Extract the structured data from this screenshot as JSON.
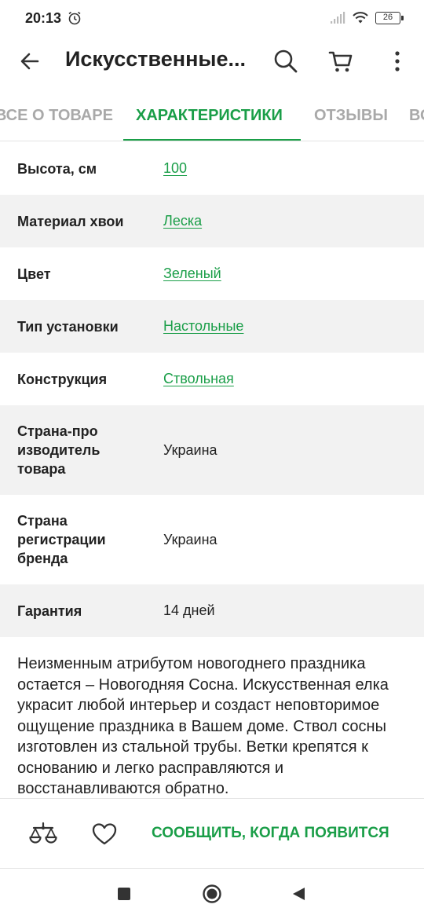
{
  "status_bar": {
    "time": "20:13",
    "battery": "26",
    "icons": [
      "alarm-icon",
      "signal-icon",
      "wifi-icon",
      "battery-icon"
    ]
  },
  "app_bar": {
    "title": "Искусственные...",
    "icons": [
      "back-arrow-icon",
      "search-icon",
      "cart-icon",
      "more-vertical-icon"
    ]
  },
  "tabs": [
    {
      "label": "ВСЕ О ТОВАРЕ",
      "active": false
    },
    {
      "label": "ХАРАКТЕРИСТИКИ",
      "active": true
    },
    {
      "label": "ОТЗЫВЫ",
      "active": false
    },
    {
      "label": "ВОПРОСЫ",
      "active": false
    }
  ],
  "specs": [
    {
      "label": "Высота, см",
      "value": "100",
      "link": true
    },
    {
      "label": "Материал хвои",
      "value": "Леска",
      "link": true
    },
    {
      "label": "Цвет",
      "value": "Зеленый",
      "link": true
    },
    {
      "label": "Тип установки",
      "value": "Настольные",
      "link": true
    },
    {
      "label": "Конструкция",
      "value": "Ствольная",
      "link": true
    },
    {
      "label": "Страна-про изводитель товара",
      "value": "Украина",
      "link": false
    },
    {
      "label": "Страна регистрации бренда",
      "value": "Украина",
      "link": false
    },
    {
      "label": "Гарантия",
      "value": "14 дней",
      "link": false
    }
  ],
  "description": "Неизменным атрибутом новогоднего праздника остается – Новогодняя Сосна. Искусственная елка украсит любой интерьер и создаст неповторимое ощущение праздника в Вашем доме. Ствол сосны изготовлен из стальной трубы. Ветки крепятся к основанию и легко расправляются и восстанавливаются обратно.",
  "action_bar": {
    "notify_label": "СООБЩИТЬ, КОГДА ПОЯВИТСЯ",
    "icons": [
      "compare-scales-icon",
      "heart-icon"
    ]
  },
  "colors": {
    "accent": "#1a9e48",
    "text": "#222222",
    "muted": "#a9a9a9",
    "row_alt": "#f2f2f2"
  }
}
